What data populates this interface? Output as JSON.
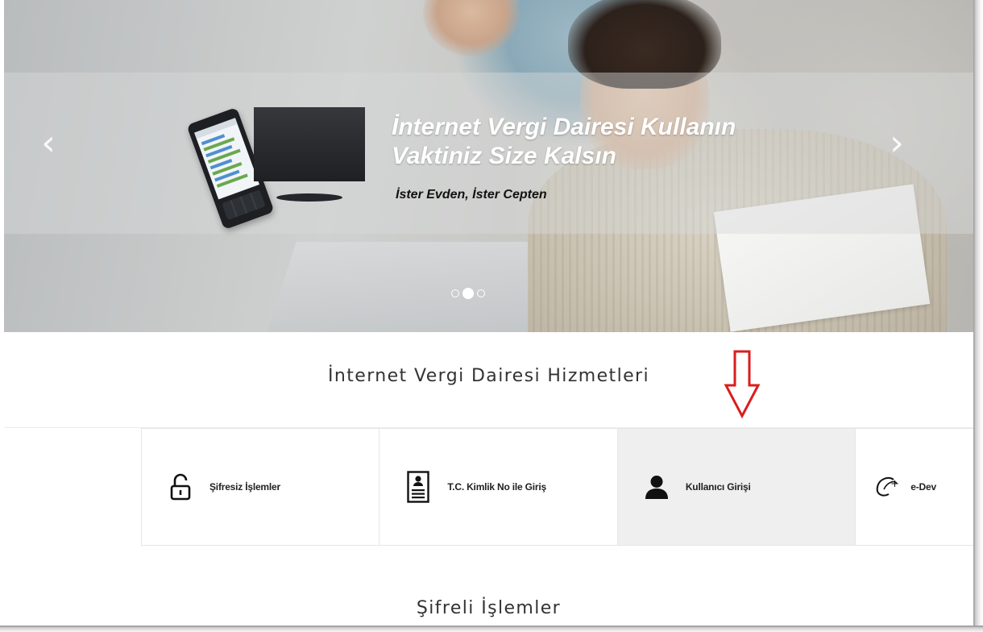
{
  "hero": {
    "title": "İnternet Vergi Dairesi Kullanın Vaktiniz Size Kalsın",
    "subtitle": "İster Evden, İster Cepten",
    "prev_glyph": "‹",
    "next_glyph": "›",
    "slides_total": 3,
    "active_slide": 2
  },
  "services": {
    "title": "İnternet Vergi Dairesi Hizmetleri",
    "tiles": [
      {
        "label": "Şifresiz İşlemler",
        "icon": "unlock-icon"
      },
      {
        "label": "T.C. Kimlik No ile Giriş",
        "icon": "id-card-icon"
      },
      {
        "label": "Kullanıcı Girişi",
        "icon": "user-icon",
        "active": true
      },
      {
        "label": "e-Dev",
        "icon": "e-devlet-icon"
      }
    ]
  },
  "secure": {
    "title": "Şifreli İşlemler"
  },
  "colors": {
    "annotation_arrow": "#d81e1e",
    "active_tile_bg": "#efefef"
  }
}
